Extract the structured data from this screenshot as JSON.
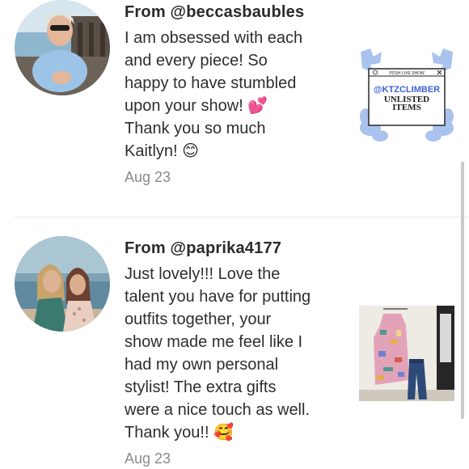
{
  "reviews": [
    {
      "from": "From @beccasbaubles",
      "text_lines": [
        "I am obsessed with each",
        "and every piece! So",
        "happy to have stumbled",
        "upon your show! 💕",
        "Thank you so much",
        "Kaitlyn! 😊"
      ],
      "date": "Aug 23",
      "thumbnail": {
        "header": "POSH LIVE SHOW",
        "handle": "@KTZCLIMBER",
        "title_line1": "UNLISTED",
        "title_line2": "ITEMS"
      }
    },
    {
      "from": "From @paprika4177",
      "text_lines": [
        "Just lovely!!! Love the",
        "talent you have for putting",
        "outfits together, your",
        "show made me feel like I",
        "had my own personal",
        "stylist! The extra gifts",
        "were a nice touch as well.",
        "Thank you!! 🥰"
      ],
      "date": "Aug 23"
    }
  ],
  "colors": {
    "accent_blue": "#3b63d6",
    "flower_blue": "#a9c2ee",
    "date_gray": "#8a8a8a"
  }
}
